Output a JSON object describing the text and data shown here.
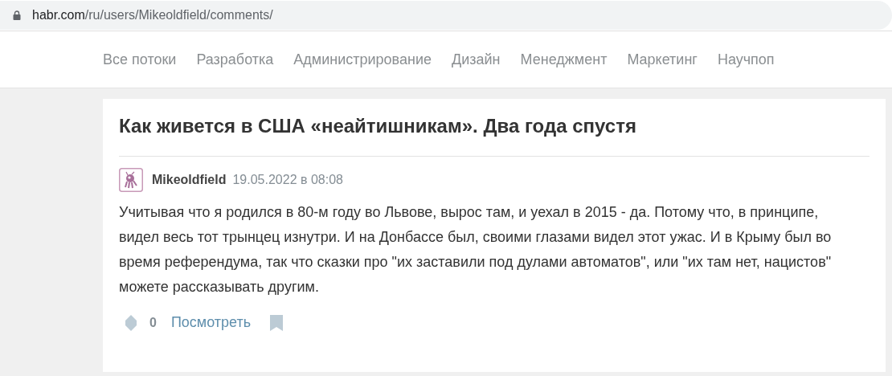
{
  "address_bar": {
    "host": "habr.com",
    "path": "/ru/users/Mikeoldfield/comments/"
  },
  "nav": [
    {
      "label": "Все потоки"
    },
    {
      "label": "Разработка"
    },
    {
      "label": "Администрирование"
    },
    {
      "label": "Дизайн"
    },
    {
      "label": "Менеджмент"
    },
    {
      "label": "Маркетинг"
    },
    {
      "label": "Научпоп"
    }
  ],
  "comment": {
    "article_title": "Как живется в США «неайтишникам». Два года спустя",
    "author": "Mikeoldfield",
    "date": "19.05.2022 в 08:08",
    "text": "Учитывая что я родился в 80-м году во Львове, вырос там, и уехал в 2015 - да. Потому что, в принципе, видел весь тот трынцец изнутри. И на Донбассе был, своими глазами видел этот ужас. И в Крыму был во время референдума, так что сказки про \"их заставили под дулами автоматов\", или \"их там нет, нацистов\" можете рассказывать другим.",
    "score": "0",
    "view_link": "Посмотреть"
  }
}
